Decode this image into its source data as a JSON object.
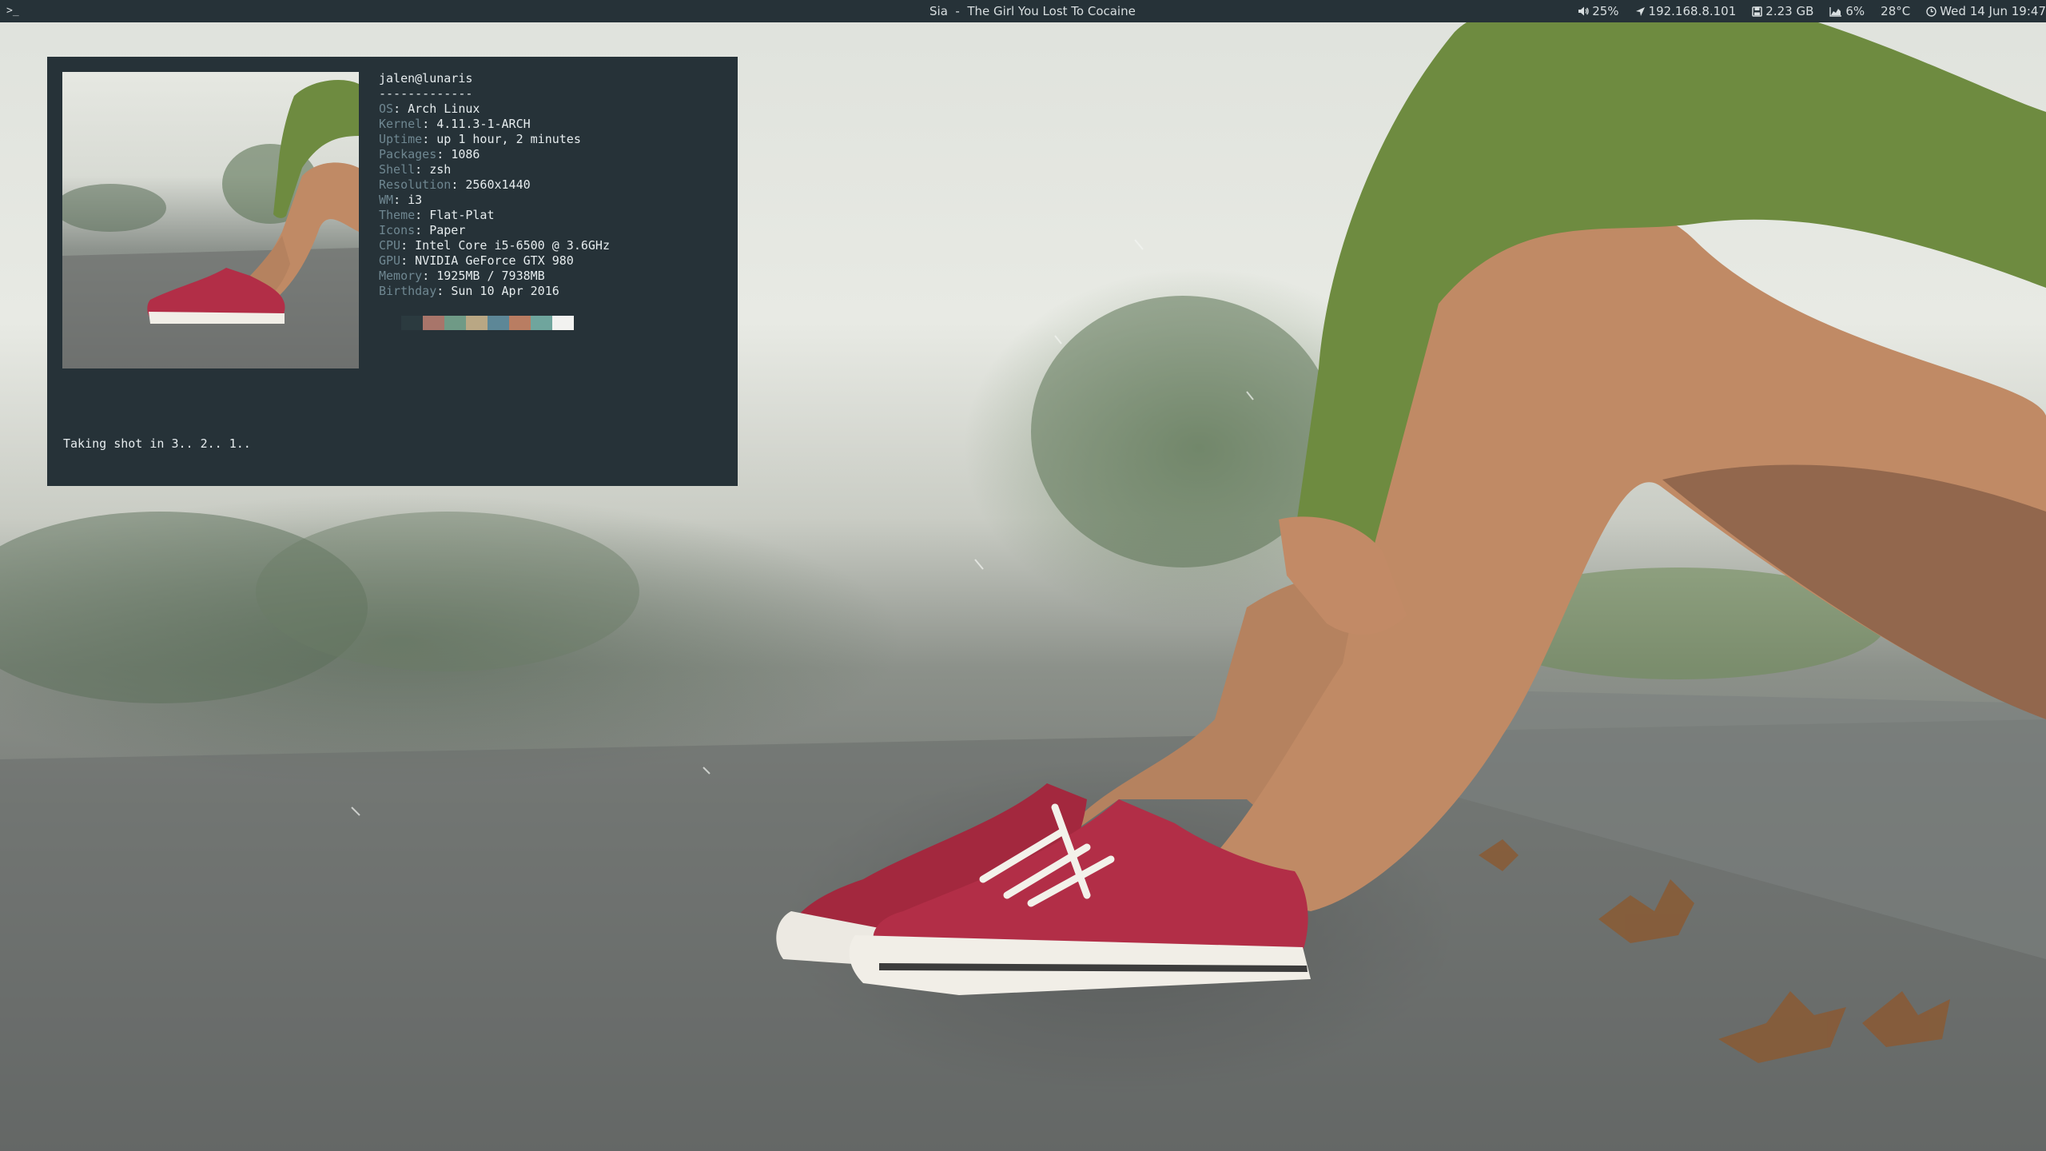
{
  "topbar": {
    "launcher_glyph": ">_",
    "now_playing": "Sia  -  The Girl You Lost To Cocaine",
    "volume": "25%",
    "ip": "192.168.8.101",
    "disk": "2.23 GB",
    "cpu": "6%",
    "temperature": "28°C",
    "datetime": "Wed 14 Jun 19:47",
    "icons": [
      "volume-icon",
      "location-arrow-icon",
      "disk-icon",
      "cpu-chart-icon",
      "clock-icon"
    ]
  },
  "terminal": {
    "user_host": "jalen@lunaris",
    "separator": "-------------",
    "info": [
      {
        "key": "OS",
        "value": "Arch Linux"
      },
      {
        "key": "Kernel",
        "value": "4.11.3-1-ARCH"
      },
      {
        "key": "Uptime",
        "value": "up 1 hour, 2 minutes"
      },
      {
        "key": "Packages",
        "value": "1086"
      },
      {
        "key": "Shell",
        "value": "zsh"
      },
      {
        "key": "Resolution",
        "value": "2560x1440"
      },
      {
        "key": "WM",
        "value": "i3"
      },
      {
        "key": "Theme",
        "value": "Flat-Plat"
      },
      {
        "key": "Icons",
        "value": "Paper"
      },
      {
        "key": "CPU",
        "value": "Intel Core i5-6500 @ 3.6GHz"
      },
      {
        "key": "GPU",
        "value": "NVIDIA GeForce GTX 980"
      },
      {
        "key": "Memory",
        "value": "1925MB / 7938MB"
      },
      {
        "key": "Birthday",
        "value": "Sun 10 Apr 2016"
      }
    ],
    "palette": [
      "#2b3a3f",
      "#a8756a",
      "#6f9a86",
      "#b9a784",
      "#5d8797",
      "#b97d62",
      "#6fa59d",
      "#f2f2f0"
    ],
    "prompt_text": "Taking shot in 3.. 2.. 1.."
  },
  "colors": {
    "bar_bg": "#263238",
    "terminal_bg": "#263238",
    "label": "#6f8791",
    "text": "#e6ecee"
  }
}
